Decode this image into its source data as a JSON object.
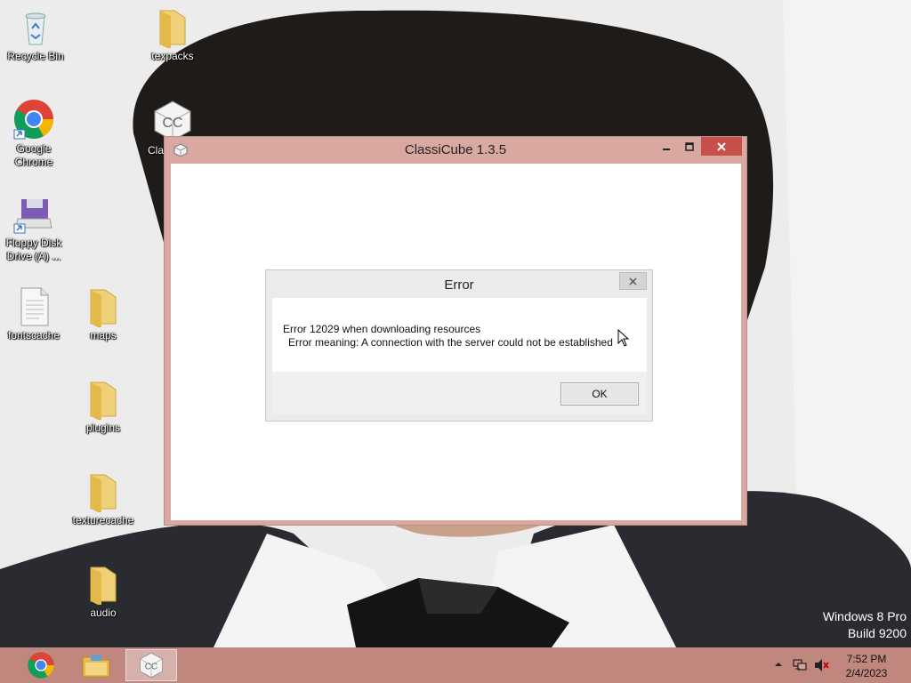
{
  "desktop": {
    "icons": [
      {
        "label": "Recycle Bin",
        "icon": "recycle-bin-icon"
      },
      {
        "label": "texpacks",
        "icon": "folder-icon"
      },
      {
        "label": "Google Chrome",
        "icon": "chrome-icon"
      },
      {
        "label": "Cla",
        "icon": "classicube-icon"
      },
      {
        "label": "Floppy Disk Drive (A) ...",
        "icon": "floppy-disk-icon"
      },
      {
        "label": "fontscache",
        "icon": "file-icon"
      },
      {
        "label": "maps",
        "icon": "folder-icon"
      },
      {
        "label": "plugins",
        "icon": "folder-icon"
      },
      {
        "label": "texturecache",
        "icon": "folder-icon"
      },
      {
        "label": "audio",
        "icon": "folder-icon"
      }
    ]
  },
  "main_window": {
    "title": "ClassiCube 1.3.5",
    "controls": {
      "minimize": "minimize-icon",
      "maximize": "maximize-icon",
      "close": "close-icon"
    }
  },
  "error_dialog": {
    "title": "Error",
    "message_line1": "Error 12029 when downloading resources",
    "message_line2": "Error meaning: A connection with the server could not be established",
    "ok_label": "OK"
  },
  "watermark": {
    "line1": "Windows 8 Pro",
    "line2": "Build 9200"
  },
  "taskbar": {
    "pinned": [
      {
        "name": "Google Chrome",
        "icon": "chrome-icon"
      },
      {
        "name": "File Explorer",
        "icon": "file-explorer-icon"
      },
      {
        "name": "ClassiCube",
        "icon": "classicube-icon",
        "active": true
      }
    ],
    "tray": [
      "show-hidden-icons",
      "network-icon",
      "volume-muted-icon"
    ],
    "clock": {
      "time": "7:52 PM",
      "date": "2/4/2023"
    }
  },
  "colors": {
    "window_frame": "#d9a8a0",
    "taskbar": "#c0877f",
    "close_button": "#c7504a"
  }
}
